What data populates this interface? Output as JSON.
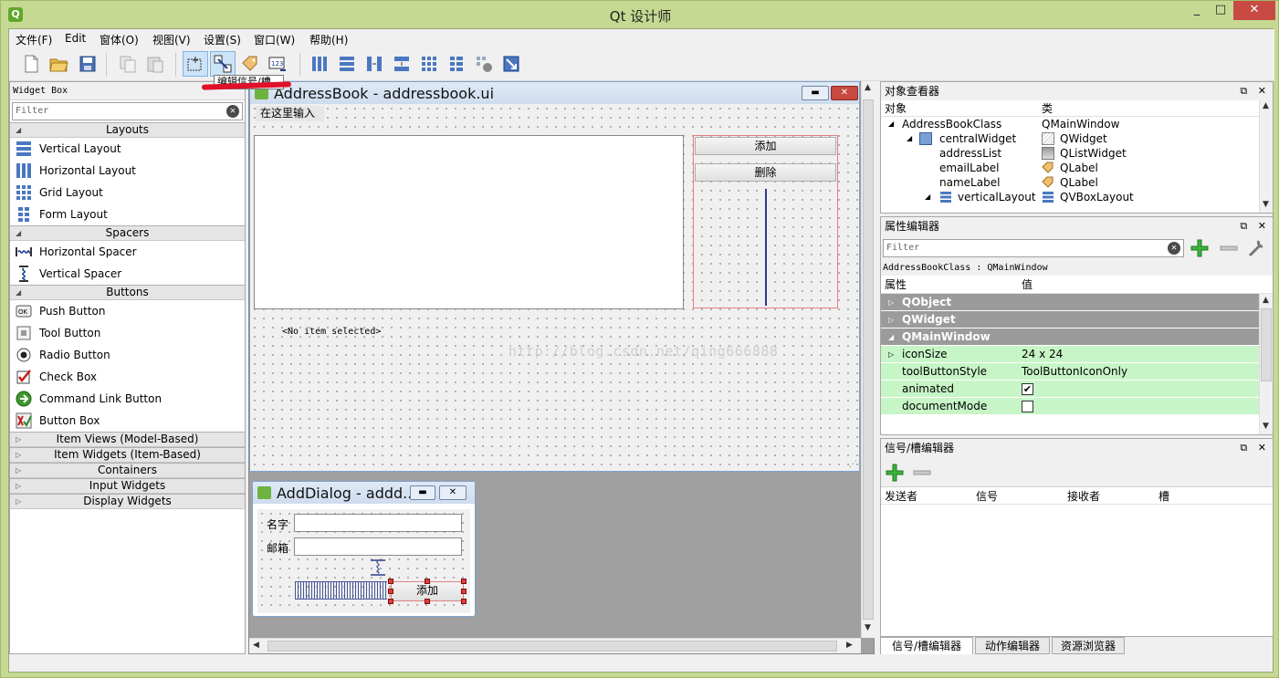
{
  "window": {
    "title": "Qt 设计师",
    "controls": {
      "minimize": "_",
      "maximize": "□",
      "close": "✕"
    }
  },
  "menu": [
    "文件(F)",
    "Edit",
    "窗体(O)",
    "视图(V)",
    "设置(S)",
    "窗口(W)",
    "帮助(H)"
  ],
  "toolbar": {
    "tooltip": "编辑信号/槽"
  },
  "widget_box": {
    "title": "Widget Box",
    "filter_placeholder": "Filter",
    "categories": {
      "layouts": "Layouts",
      "spacers": "Spacers",
      "buttons": "Buttons",
      "item_views": "Item Views (Model-Based)",
      "item_widgets": "Item Widgets (Item-Based)",
      "containers": "Containers",
      "input_widgets": "Input Widgets",
      "display_widgets": "Display Widgets"
    },
    "layout_items": [
      "Vertical Layout",
      "Horizontal Layout",
      "Grid Layout",
      "Form Layout"
    ],
    "spacer_items": [
      "Horizontal Spacer",
      "Vertical Spacer"
    ],
    "button_items": [
      "Push Button",
      "Tool Button",
      "Radio Button",
      "Check Box",
      "Command Link Button",
      "Button Box"
    ]
  },
  "main_form": {
    "title": "AddressBook - addressbook.ui",
    "menu_placeholder": "在这里输入",
    "add_button": "添加",
    "delete_button": "删除",
    "no_item_label": "<No item selected>",
    "watermark": "http://blog.csdn.net/qing666888"
  },
  "dialog_form": {
    "title": "AddDialog - addd...",
    "name_label": "名字",
    "email_label": "邮箱",
    "add_button": "添加"
  },
  "object_inspector": {
    "title": "对象查看器",
    "col_object": "对象",
    "col_class": "类",
    "rows": [
      {
        "name": "AddressBookClass",
        "class": "QMainWindow"
      },
      {
        "name": "centralWidget",
        "class": "QWidget"
      },
      {
        "name": "addressList",
        "class": "QListWidget"
      },
      {
        "name": "emailLabel",
        "class": "QLabel"
      },
      {
        "name": "nameLabel",
        "class": "QLabel"
      },
      {
        "name": "verticalLayout",
        "class": "QVBoxLayout"
      }
    ]
  },
  "property_editor": {
    "title": "属性编辑器",
    "filter_placeholder": "Filter",
    "context": "AddressBookClass : QMainWindow",
    "col_property": "属性",
    "col_value": "值",
    "groups": [
      "QObject",
      "QWidget",
      "QMainWindow"
    ],
    "rows": [
      {
        "name": "iconSize",
        "value": "24 x 24"
      },
      {
        "name": "toolButtonStyle",
        "value": "ToolButtonIconOnly"
      },
      {
        "name": "animated",
        "value": "✔"
      },
      {
        "name": "documentMode",
        "value": ""
      }
    ]
  },
  "signal_slot_editor": {
    "title": "信号/槽编辑器",
    "columns": [
      "发送者",
      "信号",
      "接收者",
      "槽"
    ]
  },
  "bottom_tabs": [
    "信号/槽编辑器",
    "动作编辑器",
    "资源浏览器"
  ],
  "colors": {
    "accent_green": "#c7f5c7",
    "group_gray": "#9b9b9b",
    "close_red": "#c74b43",
    "frame_green": "#c6d992"
  }
}
